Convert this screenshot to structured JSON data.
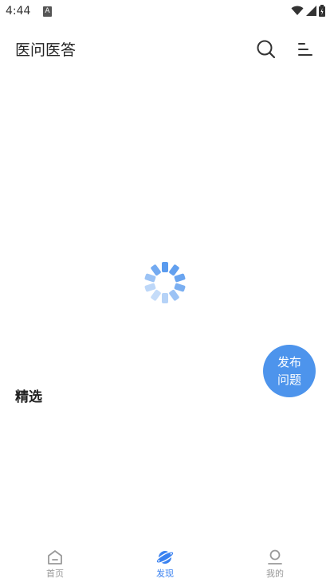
{
  "status_bar": {
    "time": "4:44",
    "app_icon_letter": "A"
  },
  "header": {
    "title": "医问医答"
  },
  "main": {
    "section_title": "精选"
  },
  "fab": {
    "line1": "发布",
    "line2": "问题"
  },
  "bottom_nav": {
    "items": [
      {
        "label": "首页",
        "icon": "home-icon",
        "active": false
      },
      {
        "label": "发现",
        "icon": "planet-icon",
        "active": true
      },
      {
        "label": "我的",
        "icon": "user-icon",
        "active": false
      }
    ]
  },
  "colors": {
    "accent": "#4d94ec",
    "active_tab": "#3b82f0",
    "inactive_tab": "#999999"
  }
}
